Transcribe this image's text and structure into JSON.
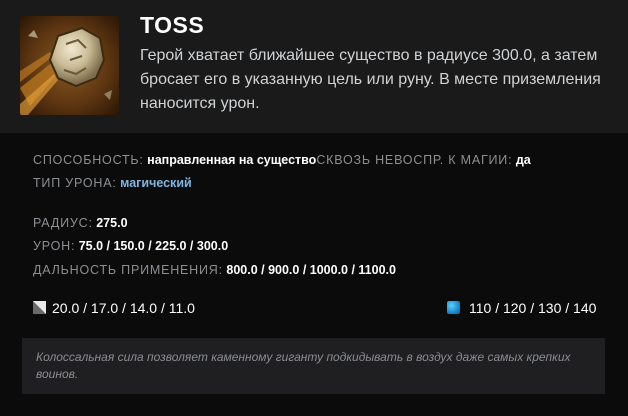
{
  "ability": {
    "name": "TOSS",
    "description": "Герой хватает ближайшее существо в радиусе 300.0, а затем бросает его в указанную цель или руну. В месте приземления наносится урон.",
    "icon": "boulder-toss-icon"
  },
  "stats": {
    "ability_label": "СПОСОБНОСТЬ:",
    "ability_value": "направленная на существо",
    "spell_immunity_label": "СКВОЗЬ НЕВОСПР. К МАГИИ:",
    "spell_immunity_value": "да",
    "damage_type_label": "ТИП УРОНА:",
    "damage_type_value": "магический",
    "radius_label": "РАДИУС:",
    "radius_value": "275.0",
    "damage_label": "УРОН:",
    "damage_value": "75.0 / 150.0 / 225.0 / 300.0",
    "cast_range_label": "ДАЛЬНОСТЬ ПРИМЕНЕНИЯ:",
    "cast_range_value": "800.0 / 900.0 / 1000.0 / 1100.0"
  },
  "costs": {
    "cooldown": "20.0 / 17.0 / 14.0 / 11.0",
    "mana": "110 / 120 / 130 / 140"
  },
  "lore": "Колоссальная сила позволяет каменному гиганту подкидывать в воздух даже самых крепких воинов.",
  "colors": {
    "header_bg": "#1a1a1b",
    "body_bg": "#0b0b0c",
    "label": "#8c8f92",
    "damage_type": "#7fb6e0",
    "mana": "#1a8ad0"
  }
}
